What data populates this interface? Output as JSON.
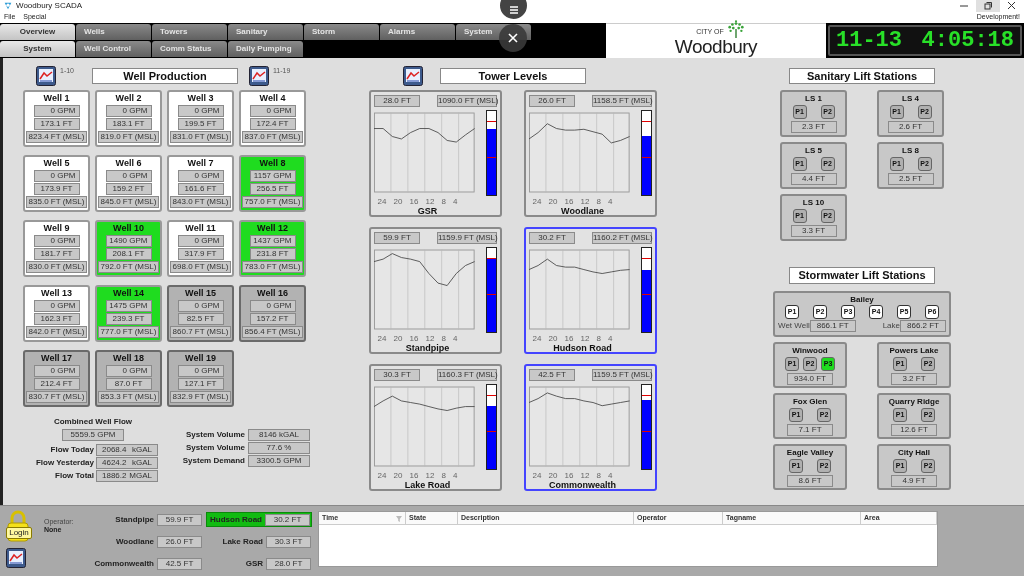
{
  "window": {
    "title": "Woodbury SCADA"
  },
  "menu": [
    "File",
    "Special"
  ],
  "mode_label": "Development!",
  "tabs_primary": [
    {
      "label": "Overview",
      "selected": true
    },
    {
      "label": "Wells",
      "selected": false
    },
    {
      "label": "Towers",
      "selected": false
    },
    {
      "label": "Sanitary",
      "selected": false
    },
    {
      "label": "Storm",
      "selected": false
    },
    {
      "label": "Alarms",
      "selected": false
    },
    {
      "label": "System",
      "selected": false
    }
  ],
  "tabs_secondary": [
    {
      "label": "System",
      "selected": true
    },
    {
      "label": "Well Control",
      "selected": false
    },
    {
      "label": "Comm Status",
      "selected": false
    },
    {
      "label": "Daily Pumping",
      "selected": false
    }
  ],
  "logo": {
    "small_text": "CITY OF",
    "name": "Woodbury"
  },
  "clock": {
    "date": "11-13",
    "time": "4:05:18"
  },
  "well_production": {
    "title": "Well Production",
    "range_left": "1-10",
    "range_right": "11-19",
    "wells": [
      {
        "name": "Well 1",
        "running": false,
        "offline": false,
        "flow": "0 GPM",
        "depth": "173.1 FT",
        "elevation": "823.4 FT (MSL)"
      },
      {
        "name": "Well 2",
        "running": false,
        "offline": false,
        "flow": "0 GPM",
        "depth": "183.1 FT",
        "elevation": "819.0 FT (MSL)"
      },
      {
        "name": "Well 3",
        "running": false,
        "offline": false,
        "flow": "0 GPM",
        "depth": "199.5 FT",
        "elevation": "831.0 FT (MSL)"
      },
      {
        "name": "Well 4",
        "running": false,
        "offline": false,
        "flow": "0 GPM",
        "depth": "172.4 FT",
        "elevation": "837.0 FT (MSL)"
      },
      {
        "name": "Well 5",
        "running": false,
        "offline": false,
        "flow": "0 GPM",
        "depth": "173.9 FT",
        "elevation": "835.0 FT (MSL)"
      },
      {
        "name": "Well 6",
        "running": false,
        "offline": false,
        "flow": "0 GPM",
        "depth": "159.2 FT",
        "elevation": "845.0 FT (MSL)"
      },
      {
        "name": "Well 7",
        "running": false,
        "offline": false,
        "flow": "0 GPM",
        "depth": "161.6 FT",
        "elevation": "843.0 FT (MSL)"
      },
      {
        "name": "Well 8",
        "running": true,
        "offline": false,
        "flow": "1157 GPM",
        "depth": "256.5 FT",
        "elevation": "757.0 FT (MSL)"
      },
      {
        "name": "Well 9",
        "running": false,
        "offline": false,
        "flow": "0 GPM",
        "depth": "181.7 FT",
        "elevation": "830.0 FT (MSL)"
      },
      {
        "name": "Well 10",
        "running": true,
        "offline": false,
        "flow": "1490 GPM",
        "depth": "208.1 FT",
        "elevation": "792.0 FT (MSL)"
      },
      {
        "name": "Well 11",
        "running": false,
        "offline": false,
        "flow": "0 GPM",
        "depth": "317.9 FT",
        "elevation": "698.0 FT (MSL)"
      },
      {
        "name": "Well 12",
        "running": true,
        "offline": false,
        "flow": "1437 GPM",
        "depth": "231.8 FT",
        "elevation": "783.0 FT (MSL)"
      },
      {
        "name": "Well 13",
        "running": false,
        "offline": false,
        "flow": "0 GPM",
        "depth": "162.3 FT",
        "elevation": "842.0 FT (MSL)"
      },
      {
        "name": "Well 14",
        "running": true,
        "offline": false,
        "flow": "1475 GPM",
        "depth": "239.3 FT",
        "elevation": "777.0 FT (MSL)"
      },
      {
        "name": "Well 15",
        "running": false,
        "offline": true,
        "flow": "0 GPM",
        "depth": "82.5 FT",
        "elevation": "860.7 FT (MSL)"
      },
      {
        "name": "Well 16",
        "running": false,
        "offline": true,
        "flow": "0 GPM",
        "depth": "157.2 FT",
        "elevation": "856.4 FT (MSL)"
      },
      {
        "name": "Well 17",
        "running": false,
        "offline": true,
        "flow": "0 GPM",
        "depth": "212.4 FT",
        "elevation": "830.7 FT (MSL)"
      },
      {
        "name": "Well 18",
        "running": false,
        "offline": true,
        "flow": "0 GPM",
        "depth": "87.0 FT",
        "elevation": "853.3 FT (MSL)"
      },
      {
        "name": "Well 19",
        "running": false,
        "offline": true,
        "flow": "0 GPM",
        "depth": "127.1 FT",
        "elevation": "832.9 FT (MSL)"
      }
    ]
  },
  "combined_flow": {
    "label": "Combined Well Flow",
    "value": "5559.5 GPM"
  },
  "flows": [
    {
      "label": "Flow Today",
      "value": "2068.4",
      "unit": "kGAL"
    },
    {
      "label": "Flow Yesterday",
      "value": "4624.2",
      "unit": "kGAL"
    },
    {
      "label": "Flow Total",
      "value": "1886.2",
      "unit": "MGAL"
    }
  ],
  "system": [
    {
      "label": "System Volume",
      "value": "8146 kGAL"
    },
    {
      "label": "System Volume",
      "value": "77.6 %"
    },
    {
      "label": "System Demand",
      "value": "3300.5 GPM"
    }
  ],
  "tower_levels": {
    "title": "Tower Levels",
    "towers": [
      {
        "name": "GSR",
        "reading": "28.0 FT",
        "elevation": "1090.0 FT (MSL)",
        "level": 0.79,
        "selected": false,
        "axis_labels": [
          "24",
          "20",
          "16",
          "12",
          "8",
          "4"
        ]
      },
      {
        "name": "Woodlane",
        "reading": "26.0 FT",
        "elevation": "1158.5 FT (MSL)",
        "level": 0.7,
        "selected": false,
        "axis_labels": [
          "24",
          "20",
          "16",
          "12",
          "8",
          "4"
        ]
      },
      {
        "name": "Standpipe",
        "reading": "59.9 FT",
        "elevation": "1159.9 FT (MSL)",
        "level": 0.88,
        "selected": false,
        "axis_labels": [
          "24",
          "20",
          "16",
          "12",
          "8",
          "4"
        ]
      },
      {
        "name": "Hudson Road",
        "reading": "30.2 FT",
        "elevation": "1160.2 FT (MSL)",
        "level": 0.74,
        "selected": true,
        "axis_labels": [
          "24",
          "20",
          "16",
          "12",
          "8",
          "4"
        ]
      },
      {
        "name": "Lake Road",
        "reading": "30.3 FT",
        "elevation": "1160.3 FT (MSL)",
        "level": 0.75,
        "selected": false,
        "axis_labels": [
          "24",
          "20",
          "16",
          "12",
          "8",
          "4"
        ]
      },
      {
        "name": "Commonwealth",
        "reading": "42.5 FT",
        "elevation": "1159.5 FT (MSL)",
        "level": 0.82,
        "selected": true,
        "axis_labels": [
          "24",
          "20",
          "16",
          "12",
          "8",
          "4"
        ]
      }
    ]
  },
  "sanitary": {
    "title": "Sanitary Lift Stations",
    "stations": [
      {
        "name": "LS 1",
        "pumps": [
          {
            "label": "P1",
            "on": false,
            "ready": false
          },
          {
            "label": "P2",
            "on": false,
            "ready": false
          }
        ],
        "reading": "2.3 FT"
      },
      {
        "name": "LS 4",
        "pumps": [
          {
            "label": "P1",
            "on": false,
            "ready": false
          },
          {
            "label": "P2",
            "on": false,
            "ready": false
          }
        ],
        "reading": "2.6 FT"
      },
      {
        "name": "LS 5",
        "pumps": [
          {
            "label": "P1",
            "on": false,
            "ready": false
          },
          {
            "label": "P2",
            "on": false,
            "ready": false
          }
        ],
        "reading": "4.4 FT"
      },
      {
        "name": "LS 8",
        "pumps": [
          {
            "label": "P1",
            "on": false,
            "ready": false
          },
          {
            "label": "P2",
            "on": false,
            "ready": false
          }
        ],
        "reading": "2.5 FT"
      },
      {
        "name": "LS 10",
        "pumps": [
          {
            "label": "P1",
            "on": false,
            "ready": false
          },
          {
            "label": "P2",
            "on": false,
            "ready": false
          }
        ],
        "reading": "3.3 FT"
      }
    ]
  },
  "stormwater": {
    "title": "Stormwater Lift Stations",
    "stations": [
      {
        "name": "Bailey",
        "kind": "wide",
        "pumps": [
          {
            "label": "P1",
            "on": false,
            "ready": true
          },
          {
            "label": "P2",
            "on": false,
            "ready": true
          },
          {
            "label": "P3",
            "on": false,
            "ready": true
          },
          {
            "label": "P4",
            "on": false,
            "ready": true
          },
          {
            "label": "P5",
            "on": false,
            "ready": true
          },
          {
            "label": "P6",
            "on": false,
            "ready": true
          }
        ],
        "readings": [
          {
            "label": "Wet Well",
            "value": "866.1 FT"
          },
          {
            "label": "Lake",
            "value": "866.2 FT"
          }
        ]
      },
      {
        "name": "Winwood",
        "kind": "standard",
        "pumps": [
          {
            "label": "P1",
            "on": false,
            "ready": false
          },
          {
            "label": "P2",
            "on": false,
            "ready": false
          },
          {
            "label": "P3",
            "on": true,
            "ready": false
          }
        ],
        "reading": "934.0 FT"
      },
      {
        "name": "Powers Lake",
        "kind": "standard",
        "pumps": [
          {
            "label": "P1",
            "on": false,
            "ready": false
          },
          {
            "label": "P2",
            "on": false,
            "ready": false
          }
        ],
        "reading": "3.2 FT"
      },
      {
        "name": "Fox Glen",
        "kind": "standard",
        "pumps": [
          {
            "label": "P1",
            "on": false,
            "ready": false
          },
          {
            "label": "P2",
            "on": false,
            "ready": false
          }
        ],
        "reading": "7.1 FT"
      },
      {
        "name": "Quarry Ridge",
        "kind": "standard",
        "pumps": [
          {
            "label": "P1",
            "on": false,
            "ready": false
          },
          {
            "label": "P2",
            "on": false,
            "ready": false
          }
        ],
        "reading": "12.6 FT"
      },
      {
        "name": "Eagle Valley",
        "kind": "standard",
        "pumps": [
          {
            "label": "P1",
            "on": false,
            "ready": false
          },
          {
            "label": "P2",
            "on": false,
            "ready": false
          }
        ],
        "reading": "8.6 FT"
      },
      {
        "name": "City Hall",
        "kind": "standard",
        "pumps": [
          {
            "label": "P1",
            "on": false,
            "ready": false
          },
          {
            "label": "P2",
            "on": false,
            "ready": false
          }
        ],
        "reading": "4.9 FT"
      }
    ]
  },
  "footer": {
    "login_label": "Login",
    "operator_label": "Operator:",
    "operator": "None",
    "tower_readouts": [
      {
        "name": "Standpipe",
        "value": "59.9 FT",
        "highlighted": false
      },
      {
        "name": "Hudson Road",
        "value": "30.2 FT",
        "highlighted": true
      },
      {
        "name": "Woodlane",
        "value": "26.0 FT",
        "highlighted": false
      },
      {
        "name": "Lake Road",
        "value": "30.3 FT",
        "highlighted": false
      },
      {
        "name": "Commonwealth",
        "value": "42.5 FT",
        "highlighted": false
      },
      {
        "name": "GSR",
        "value": "28.0 FT",
        "highlighted": false
      }
    ],
    "alarm_table": {
      "columns": [
        "Time",
        "State",
        "Description",
        "Operator",
        "Tagname",
        "Area"
      ]
    }
  }
}
